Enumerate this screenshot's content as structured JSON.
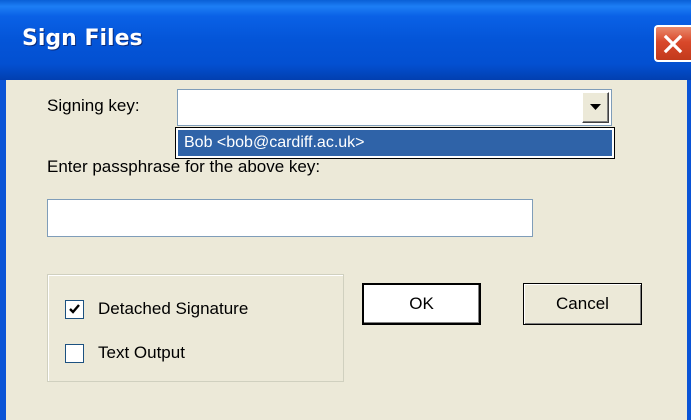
{
  "window": {
    "title": "Sign Files"
  },
  "signing_key": {
    "label": "Signing key:",
    "value": "",
    "options": [
      "Bob <bob@cardiff.ac.uk>"
    ],
    "highlighted_option": "Bob <bob@cardiff.ac.uk>"
  },
  "passphrase": {
    "label": "Enter passphrase for the above key:",
    "value": ""
  },
  "options": {
    "detached_signature": {
      "label": "Detached Signature",
      "checked": true
    },
    "text_output": {
      "label": "Text Output",
      "checked": false
    }
  },
  "buttons": {
    "ok_label": "OK",
    "cancel_label": "Cancel"
  },
  "icons": {
    "close": "close-icon",
    "dropdown": "chevron-down-icon",
    "check": "checkmark-icon"
  },
  "colors": {
    "titlebar": "#0453d4",
    "selection": "#2f63a8",
    "close_button": "#d9482a",
    "dialog_bg": "#ece9d8"
  }
}
